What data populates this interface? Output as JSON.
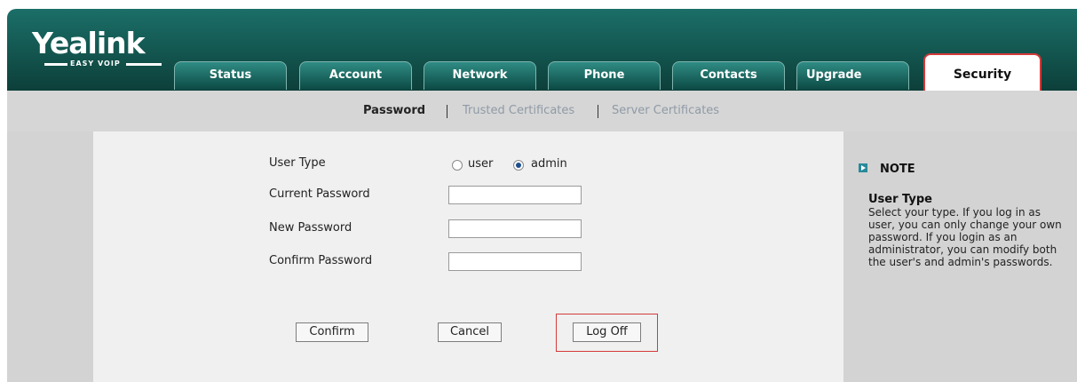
{
  "brand": {
    "name": "Yealink",
    "tagline": "EASY VOIP"
  },
  "tabs": [
    {
      "label": "Status"
    },
    {
      "label": "Account"
    },
    {
      "label": "Network"
    },
    {
      "label": "Phone"
    },
    {
      "label": "Contacts"
    },
    {
      "label": "Upgrade"
    },
    {
      "label": "Security",
      "active": true
    }
  ],
  "subnav": [
    {
      "label": "Password",
      "active": true
    },
    {
      "label": "Trusted Certificates"
    },
    {
      "label": "Server Certificates"
    }
  ],
  "form": {
    "user_type_label": "User Type",
    "user_type_options": [
      {
        "label": "user",
        "checked": false
      },
      {
        "label": "admin",
        "checked": true
      }
    ],
    "current_password_label": "Current Password",
    "current_password_value": "",
    "new_password_label": "New Password",
    "new_password_value": "",
    "confirm_password_label": "Confirm Password",
    "confirm_password_value": ""
  },
  "buttons": {
    "confirm": "Confirm",
    "cancel": "Cancel",
    "logoff": "Log Off"
  },
  "note": {
    "title": "NOTE",
    "subtitle": "User Type",
    "text": "Select your type. If you log in as user, you can only change your own password. If you login as an administrator, you can modify both the user's and admin's passwords."
  },
  "colors": {
    "header": "#0d3f3a",
    "highlight": "#d33a3a",
    "panel": "#f0f0f0",
    "side": "#d3d3d3"
  }
}
